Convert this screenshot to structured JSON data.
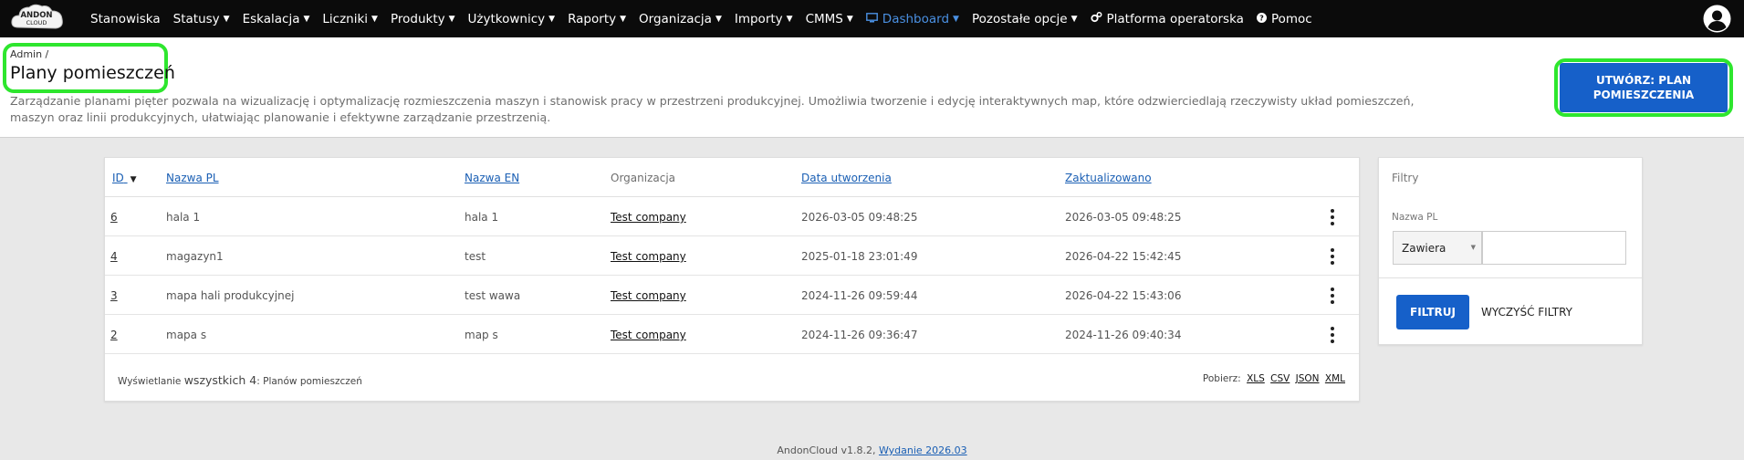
{
  "brand": {
    "logo_text_top": "ANDON",
    "logo_text_bottom": "CLOUD"
  },
  "nav": {
    "items": [
      {
        "label": "Stanowiska",
        "caret": false,
        "active": false
      },
      {
        "label": "Statusy",
        "caret": true,
        "active": false
      },
      {
        "label": "Eskalacja",
        "caret": true,
        "active": false
      },
      {
        "label": "Liczniki",
        "caret": true,
        "active": false
      },
      {
        "label": "Produkty",
        "caret": true,
        "active": false
      },
      {
        "label": "Użytkownicy",
        "caret": true,
        "active": false
      },
      {
        "label": "Raporty",
        "caret": true,
        "active": false
      },
      {
        "label": "Organizacja",
        "caret": true,
        "active": false
      },
      {
        "label": "Importy",
        "caret": true,
        "active": false
      },
      {
        "label": "CMMS",
        "caret": true,
        "active": false
      },
      {
        "label": "Dashboard",
        "caret": true,
        "active": true,
        "icon": "monitor-icon"
      },
      {
        "label": "Pozostałe opcje",
        "caret": true,
        "active": false
      },
      {
        "label": "Platforma operatorska",
        "caret": false,
        "active": false,
        "icon": "cogs-icon"
      },
      {
        "label": "Pomoc",
        "caret": false,
        "active": false,
        "icon": "question-circle-icon"
      }
    ],
    "user_icon": "user-circle-icon"
  },
  "header": {
    "breadcrumb": "Admin /",
    "title": "Plany pomieszczeń",
    "description": "Zarządzanie planami pięter pozwala na wizualizację i optymalizację rozmieszczenia maszyn i stanowisk pracy w przestrzeni produkcyjnej. Umożliwia tworzenie i edycję interaktywnych map, które odzwierciedlają rzeczywisty układ pomieszczeń, maszyn oraz linii produkcyjnych, ułatwiając planowanie i efektywne zarządzanie przestrzenią.",
    "create_button": "UTWÓRZ: PLAN POMIESZCZENIA"
  },
  "table": {
    "columns": {
      "id": "ID",
      "name_pl": "Nazwa PL",
      "name_en": "Nazwa EN",
      "organization": "Organizacja",
      "created": "Data utworzenia",
      "updated": "Zaktualizowano"
    },
    "sort_indicator": "▼",
    "rows": [
      {
        "id": "6",
        "name_pl": "hala 1",
        "name_en": "hala 1",
        "organization": "Test company",
        "created": "2026-03-05 09:48:25",
        "updated": "2026-03-05 09:48:25"
      },
      {
        "id": "4",
        "name_pl": "magazyn1",
        "name_en": "test",
        "organization": "Test company",
        "created": "2025-01-18 23:01:49",
        "updated": "2026-04-22 15:42:45"
      },
      {
        "id": "3",
        "name_pl": "mapa hali produkcyjnej",
        "name_en": "test wawa",
        "organization": "Test company",
        "created": "2024-11-26 09:59:44",
        "updated": "2026-04-22 15:43:06"
      },
      {
        "id": "2",
        "name_pl": "mapa s",
        "name_en": "map s",
        "organization": "Test company",
        "created": "2024-11-26 09:36:47",
        "updated": "2024-11-26 09:40:34"
      }
    ],
    "footer": {
      "prefix": "Wyświetlanie",
      "count_text": "wszystkich 4",
      "suffix": ": Planów pomieszczeń",
      "download_label": "Pobierz:",
      "formats": [
        "XLS",
        "CSV",
        "JSON",
        "XML"
      ]
    }
  },
  "filters": {
    "title": "Filtry",
    "field_label": "Nazwa PL",
    "operator": "Zawiera",
    "value": "",
    "apply_button": "FILTRUJ",
    "clear_button": "WYCZYŚĆ FILTRY"
  },
  "footer": {
    "version_text": "AndonCloud v1.8.2,",
    "release_link": "Wydanie 2026.03"
  },
  "colors": {
    "accent": "#1660c9",
    "highlight": "#2ee62e",
    "navbar": "#0b0b0b",
    "active_nav": "#4a90e2"
  }
}
